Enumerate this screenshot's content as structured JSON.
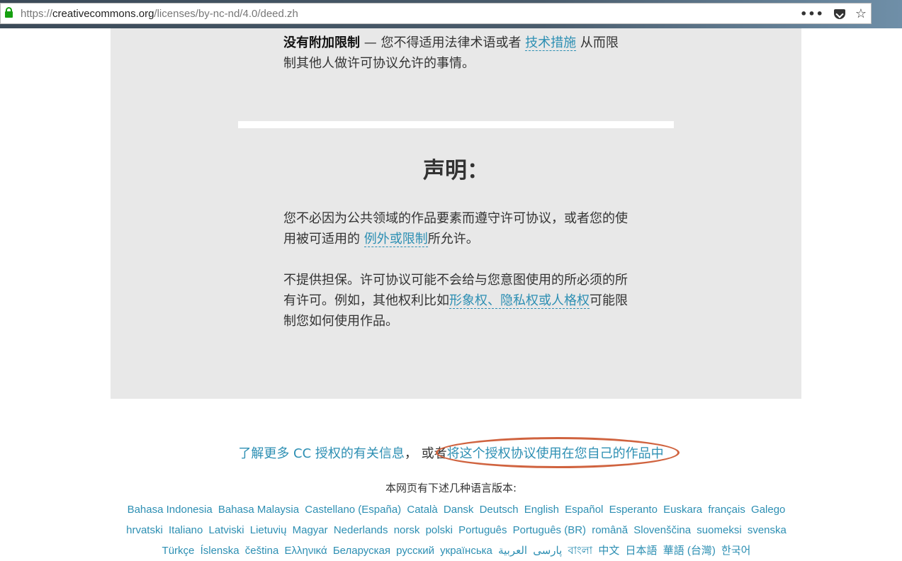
{
  "browser": {
    "url_prefix": "https://",
    "url_host": "creativecommons.org",
    "url_path": "/licenses/by-nc-nd/4.0/deed.zh",
    "menu_glyph": "•••",
    "star_glyph": "☆"
  },
  "panel": {
    "no_restrictions_label": "没有附加限制",
    "no_restrictions_text_1": " — 您不得适用法律术语或者 ",
    "no_restrictions_link": "技术措施",
    "no_restrictions_text_2": " 从而限制其他人做许可协议允许的事情。",
    "notices_title": "声明：",
    "notice1_text_1": "您不必因为公共领域的作品要素而遵守许可协议，或者您的使用被可适用的 ",
    "notice1_link": "例外或限制",
    "notice1_text_2": "所允许。",
    "notice2_text_1": "不提供担保。许可协议可能不会给与您意图使用的所必须的所有许可。例如，其他权利比如",
    "notice2_link": "形象权、隐私权或人格权",
    "notice2_text_2": "可能限制您如何使用作品。"
  },
  "footer": {
    "learn_more_link": "了解更多 CC 授权的有关信息",
    "learn_more_or": "， 或者",
    "use_license_link": "将这个授权协议使用在您自己的作品中",
    "lang_heading": "本网页有下述几种语言版本:",
    "languages": [
      "Bahasa Indonesia",
      "Bahasa Malaysia",
      "Castellano (España)",
      "Català",
      "Dansk",
      "Deutsch",
      "English",
      "Español",
      "Esperanto",
      "Euskara",
      "français",
      "Galego",
      "hrvatski",
      "Italiano",
      "Latviski",
      "Lietuvių",
      "Magyar",
      "Nederlands",
      "norsk",
      "polski",
      "Português",
      "Português (BR)",
      "română",
      "Slovenščina",
      "suomeksi",
      "svenska",
      "Türkçe",
      "Íslenska",
      "čeština",
      "Ελληνικά",
      "Беларуская",
      "русский",
      "українська",
      "پارسی",
      "العربية",
      "বাংলা",
      "中文",
      "日本語",
      "華語 (台灣)",
      "한국어"
    ]
  }
}
